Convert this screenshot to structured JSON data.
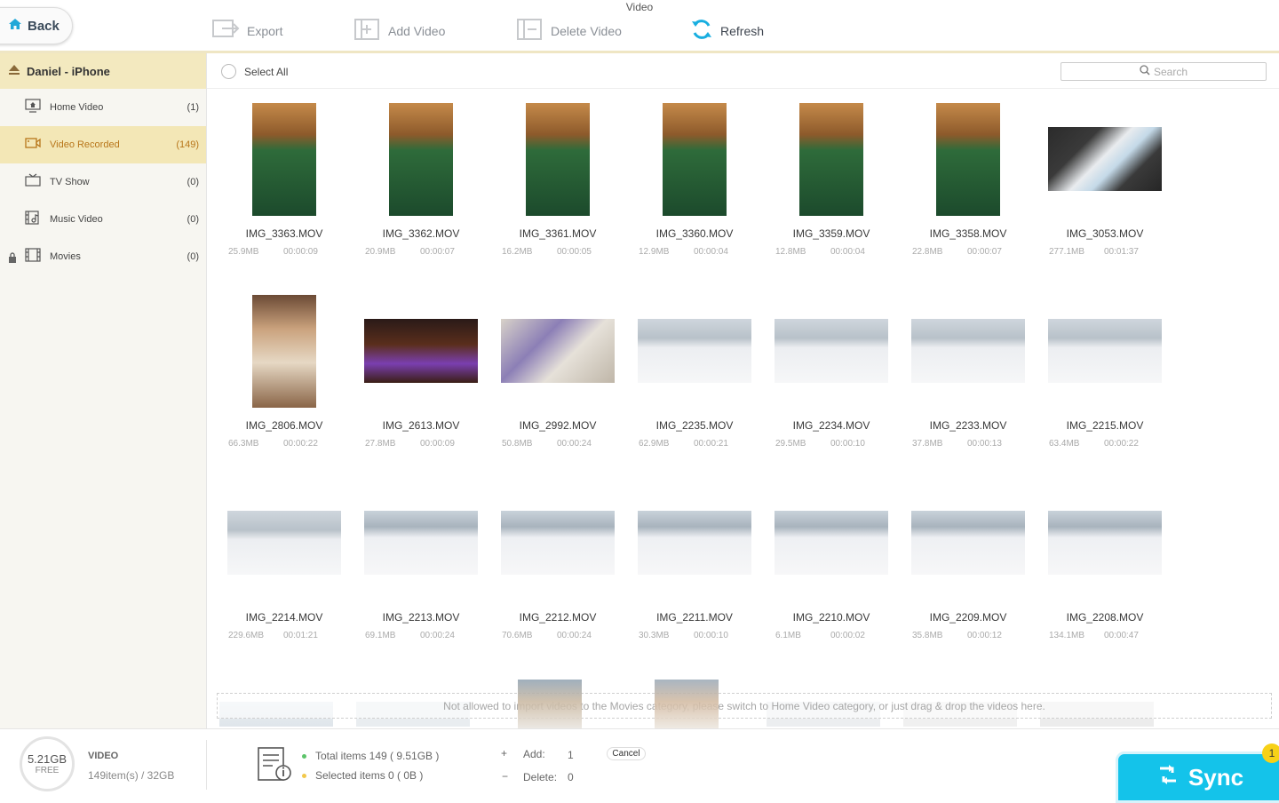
{
  "window": {
    "title": "Video"
  },
  "toolbar": {
    "back_label": "Back",
    "export_label": "Export",
    "add_label": "Add Video",
    "delete_label": "Delete Video",
    "refresh_label": "Refresh"
  },
  "sidebar": {
    "device": "Daniel - iPhone",
    "categories": [
      {
        "label": "Home Video",
        "count": "(1)"
      },
      {
        "label": "Video Recorded",
        "count": "(149)"
      },
      {
        "label": "TV Show",
        "count": "(0)"
      },
      {
        "label": "Music Video",
        "count": "(0)"
      },
      {
        "label": "Movies",
        "count": "(0)"
      }
    ]
  },
  "content": {
    "select_all": "Select All",
    "search_placeholder": "Search",
    "drop_hint": "Not allowed to  import videos to the Movies category, please switch to Home Video category, or just drag & drop the videos here."
  },
  "videos": [
    {
      "name": "IMG_3363.MOV",
      "size": "25.9MB",
      "duration": "00:00:09",
      "orientation": "portrait",
      "scene": "rock"
    },
    {
      "name": "IMG_3362.MOV",
      "size": "20.9MB",
      "duration": "00:00:07",
      "orientation": "portrait",
      "scene": "rock"
    },
    {
      "name": "IMG_3361.MOV",
      "size": "16.2MB",
      "duration": "00:00:05",
      "orientation": "portrait",
      "scene": "rock"
    },
    {
      "name": "IMG_3360.MOV",
      "size": "12.9MB",
      "duration": "00:00:04",
      "orientation": "portrait",
      "scene": "rock"
    },
    {
      "name": "IMG_3359.MOV",
      "size": "12.8MB",
      "duration": "00:00:04",
      "orientation": "portrait",
      "scene": "rock"
    },
    {
      "name": "IMG_3358.MOV",
      "size": "22.8MB",
      "duration": "00:00:07",
      "orientation": "portrait",
      "scene": "rock"
    },
    {
      "name": "IMG_3053.MOV",
      "size": "277.1MB",
      "duration": "00:01:37",
      "orientation": "landscape",
      "scene": "hand"
    },
    {
      "name": "IMG_2806.MOV",
      "size": "66.3MB",
      "duration": "00:00:22",
      "orientation": "portrait",
      "scene": "door"
    },
    {
      "name": "IMG_2613.MOV",
      "size": "27.8MB",
      "duration": "00:00:09",
      "orientation": "landscape",
      "scene": "night"
    },
    {
      "name": "IMG_2992.MOV",
      "size": "50.8MB",
      "duration": "00:00:24",
      "orientation": "landscape",
      "scene": "child"
    },
    {
      "name": "IMG_2235.MOV",
      "size": "62.9MB",
      "duration": "00:00:21",
      "orientation": "landscape",
      "scene": "snow"
    },
    {
      "name": "IMG_2234.MOV",
      "size": "29.5MB",
      "duration": "00:00:10",
      "orientation": "landscape",
      "scene": "snow"
    },
    {
      "name": "IMG_2233.MOV",
      "size": "37.8MB",
      "duration": "00:00:13",
      "orientation": "landscape",
      "scene": "snow"
    },
    {
      "name": "IMG_2215.MOV",
      "size": "63.4MB",
      "duration": "00:00:22",
      "orientation": "landscape",
      "scene": "snow"
    },
    {
      "name": "IMG_2214.MOV",
      "size": "229.6MB",
      "duration": "00:01:21",
      "orientation": "landscape",
      "scene": "snow"
    },
    {
      "name": "IMG_2213.MOV",
      "size": "69.1MB",
      "duration": "00:00:24",
      "orientation": "landscape",
      "scene": "ski"
    },
    {
      "name": "IMG_2212.MOV",
      "size": "70.6MB",
      "duration": "00:00:24",
      "orientation": "landscape",
      "scene": "ski"
    },
    {
      "name": "IMG_2211.MOV",
      "size": "30.3MB",
      "duration": "00:00:10",
      "orientation": "landscape",
      "scene": "ski"
    },
    {
      "name": "IMG_2210.MOV",
      "size": "6.1MB",
      "duration": "00:00:02",
      "orientation": "landscape",
      "scene": "ski"
    },
    {
      "name": "IMG_2209.MOV",
      "size": "35.8MB",
      "duration": "00:00:12",
      "orientation": "landscape",
      "scene": "ski"
    },
    {
      "name": "IMG_2208.MOV",
      "size": "134.1MB",
      "duration": "00:00:47",
      "orientation": "landscape",
      "scene": "ski"
    }
  ],
  "bottom": {
    "storage_free": "5.21GB",
    "free_label": "FREE",
    "section_title": "VIDEO",
    "items_summary": "149item(s) / 32GB",
    "total_items": "Total items 149 ( 9.51GB )",
    "selected_items": "Selected items 0 ( 0B )",
    "add_label": "Add:",
    "add_value": "1",
    "delete_label": "Delete:",
    "delete_value": "0",
    "cancel_label": "Cancel",
    "sync_label": "Sync",
    "sync_badge": "1",
    "total_dot_color": "#5cc46a",
    "selected_dot_color": "#f2c84b"
  },
  "colors": {
    "accent": "#14c3ea",
    "selected_category": "#b8761a",
    "sidebar_highlight": "#f3e7b6"
  }
}
